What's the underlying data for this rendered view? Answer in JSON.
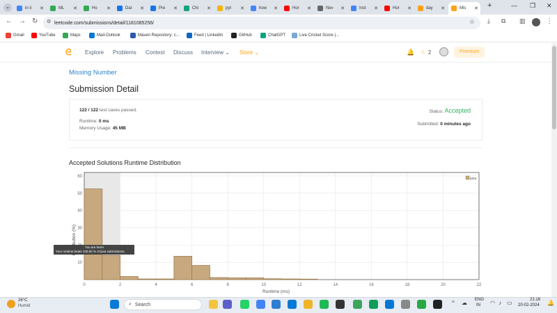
{
  "tabs": [
    {
      "label": "in ii",
      "color": "#4285f4"
    },
    {
      "label": "ML",
      "color": "#34a853"
    },
    {
      "label": "Ho",
      "color": "#34a853"
    },
    {
      "label": "Dat",
      "color": "#1a73e8"
    },
    {
      "label": "Pre",
      "color": "#1a73e8"
    },
    {
      "label": "Chi",
      "color": "#10a37f"
    },
    {
      "label": "pyt",
      "color": "#f4b400"
    },
    {
      "label": "how",
      "color": "#4285f4"
    },
    {
      "label": "Hor",
      "color": "#ff0000"
    },
    {
      "label": "Nev",
      "color": "#666666"
    },
    {
      "label": "Inst",
      "color": "#4285f4"
    },
    {
      "label": "Hor",
      "color": "#ff0000"
    },
    {
      "label": "day",
      "color": "#ffa116"
    },
    {
      "label": "Mis",
      "color": "#ffa116"
    }
  ],
  "address": "leetcode.com/submissions/detail/1181085256/",
  "bookmarks": [
    {
      "label": "Gmail",
      "color": "#ea4335"
    },
    {
      "label": "YouTube",
      "color": "#ff0000"
    },
    {
      "label": "Maps",
      "color": "#34a853"
    },
    {
      "label": "Mail-Outlook",
      "color": "#0078d4"
    },
    {
      "label": "Maven Repository: c...",
      "color": "#2f5aa8"
    },
    {
      "label": "Feed | LinkedIn",
      "color": "#0a66c2"
    },
    {
      "label": "GitHub",
      "color": "#222222"
    },
    {
      "label": "ChatGPT",
      "color": "#10a37f"
    },
    {
      "label": "Live Cricket Score |...",
      "color": "#7aa7d9"
    }
  ],
  "lcnav": {
    "explore": "Explore",
    "problems": "Problems",
    "contest": "Contest",
    "discuss": "Discuss",
    "interview": "Interview",
    "store": "Store",
    "streak": "2",
    "premium": "Premium"
  },
  "problem_title": "Missing Number",
  "page_heading": "Submission Detail",
  "submission": {
    "passed": "122 / 122",
    "passed_suffix": "test cases passed.",
    "runtime_label": "Runtime:",
    "runtime_value": "0 ms",
    "memory_label": "Memory Usage:",
    "memory_value": "45 MB",
    "status_label": "Status:",
    "status_value": "Accepted",
    "submitted_label": "Submitted:",
    "submitted_value": "0 minutes ago"
  },
  "chart_section_title": "Accepted Solutions Runtime Distribution",
  "tooltip": {
    "line1": "You are here!",
    "line2": "Your runtime beats 100.00 % of java submissions."
  },
  "chart_data": {
    "type": "bar",
    "xlabel": "Runtime (ms)",
    "ylabel": "Distribution (%)",
    "xlim": [
      0,
      22
    ],
    "ylim": [
      0,
      62
    ],
    "xticks": [
      0,
      2,
      4,
      6,
      8,
      10,
      12,
      14,
      16,
      18,
      20,
      22
    ],
    "yticks": [
      10,
      20,
      30,
      40,
      50,
      60
    ],
    "legend": [
      "java"
    ],
    "legend_position": "top-right",
    "grid": true,
    "highlight_range": [
      0,
      2
    ],
    "series": [
      {
        "name": "java",
        "color": "#c8a97f",
        "bins": [
          [
            0,
            1
          ],
          [
            1,
            2
          ],
          [
            2,
            3
          ],
          [
            3,
            4
          ],
          [
            4,
            5
          ],
          [
            5,
            6
          ],
          [
            6,
            7
          ],
          [
            7,
            8
          ],
          [
            8,
            9
          ],
          [
            9,
            10
          ],
          [
            10,
            11
          ],
          [
            11,
            12
          ],
          [
            12,
            13
          ]
        ],
        "values": [
          52.5,
          14,
          1.8,
          0.4,
          0.4,
          13.5,
          8.2,
          1.2,
          1,
          1,
          0.5,
          0.4,
          0.3
        ]
      }
    ]
  },
  "taskbar": {
    "temperature": "26°C",
    "weather": "Humid",
    "search_placeholder": "Search",
    "lang1": "ENG",
    "lang2": "IN",
    "time": "21:18",
    "date": "20-02-2024"
  }
}
